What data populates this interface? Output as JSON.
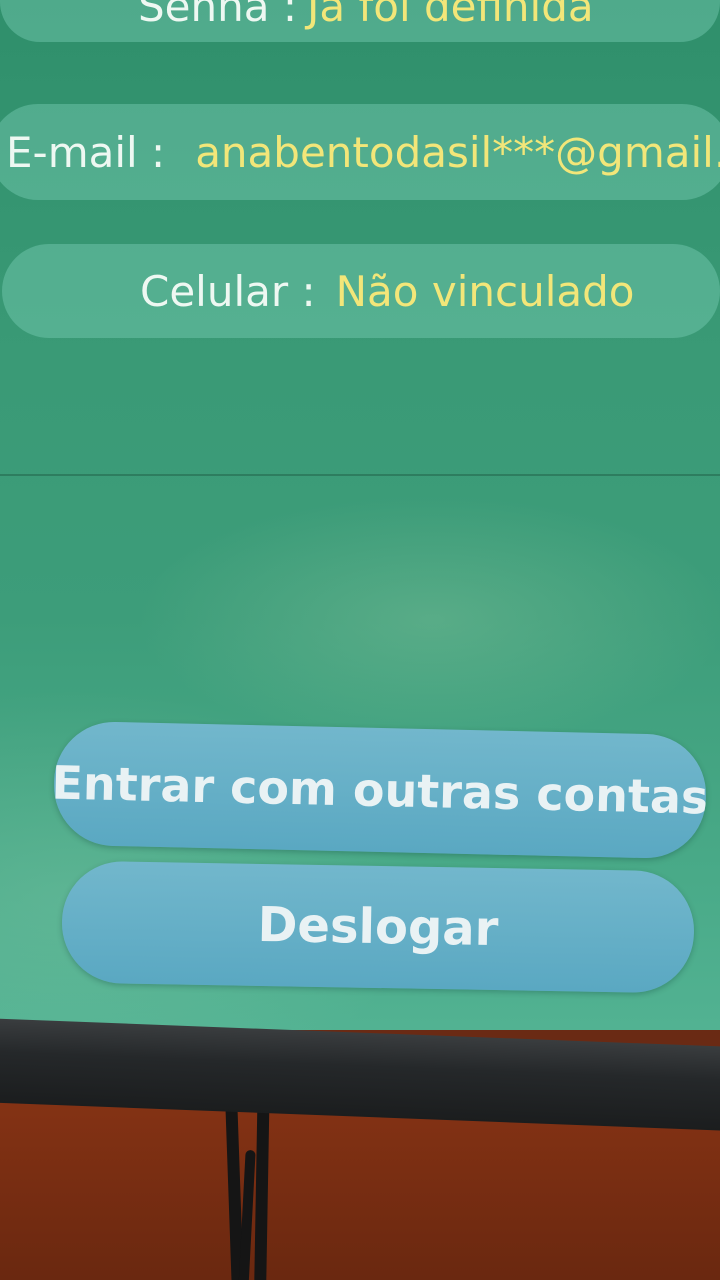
{
  "account": {
    "senha": {
      "label": "Senha :",
      "value": "Já foi definida"
    },
    "email": {
      "label": "E-mail :",
      "value": "anabentodasil***@gmail.com"
    },
    "celular": {
      "label": "Celular :",
      "value": "Não vinculado"
    }
  },
  "buttons": {
    "outras_contas": "Entrar com outras contas",
    "deslogar": "Deslogar"
  },
  "colors": {
    "screen_background": "#3a9a76",
    "label_text": "#eef8f2",
    "value_text": "#f2e679",
    "button_background": "#65b0c7",
    "wall": "#7a2e12",
    "bezel": "#25282a"
  }
}
